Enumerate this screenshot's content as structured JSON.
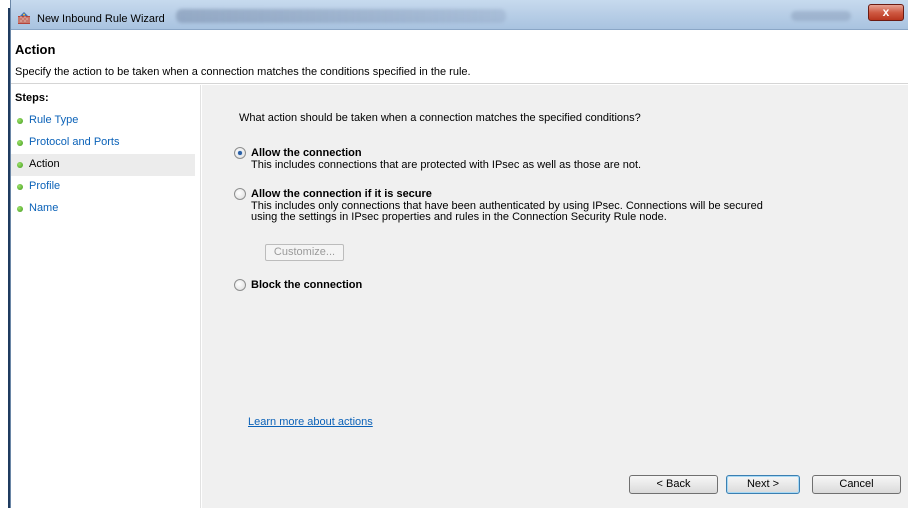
{
  "window": {
    "title": "New Inbound Rule Wizard",
    "close_glyph": "x"
  },
  "header": {
    "title": "Action",
    "description": "Specify the action to be taken when a connection matches the conditions specified in the rule."
  },
  "steps": {
    "label": "Steps:",
    "items": [
      {
        "label": "Rule Type",
        "active": false
      },
      {
        "label": "Protocol and Ports",
        "active": false
      },
      {
        "label": "Action",
        "active": true
      },
      {
        "label": "Profile",
        "active": false
      },
      {
        "label": "Name",
        "active": false
      }
    ]
  },
  "main": {
    "question": "What action should be taken when a connection matches the specified conditions?",
    "options": [
      {
        "title": "Allow the connection",
        "description": "This includes connections that are protected with IPsec as well as those are not.",
        "checked": true
      },
      {
        "title": "Allow the connection if it is secure",
        "description": "This includes only connections that have been authenticated by using IPsec.  Connections will be secured using the settings in IPsec properties and rules in the Connection Security Rule node.",
        "checked": false
      },
      {
        "title": "Block the connection",
        "description": "",
        "checked": false
      }
    ],
    "customize_label": "Customize...",
    "learn_more": "Learn more about actions"
  },
  "buttons": {
    "back": "< Back",
    "next": "Next >",
    "cancel": "Cancel"
  },
  "colors": {
    "link": "#0b62b8",
    "step_dot": "#3f9a1c",
    "content_bg": "#f0f0f0"
  }
}
